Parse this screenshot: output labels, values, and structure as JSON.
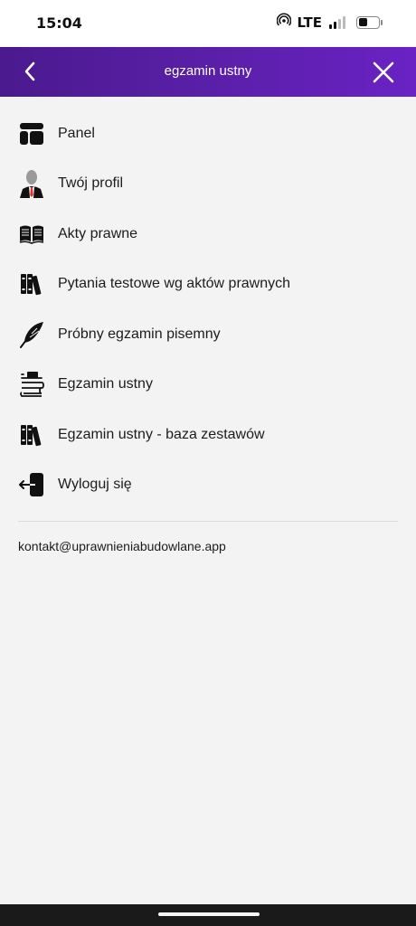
{
  "status_bar": {
    "time": "15:04",
    "network": "LTE"
  },
  "header": {
    "title": "egzamin ustny",
    "back_icon": "chevron-left-icon",
    "close_icon": "close-icon",
    "background_start": "#4a1a8e",
    "background_end": "#6a22c4"
  },
  "menu": {
    "items": [
      {
        "label": "Panel",
        "icon": "dashboard-icon"
      },
      {
        "label": "Twój profil",
        "icon": "user-profile-icon"
      },
      {
        "label": "Akty prawne",
        "icon": "open-book-icon"
      },
      {
        "label": "Pytania testowe wg aktów prawnych",
        "icon": "books-icon"
      },
      {
        "label": "Próbny egzamin pisemny",
        "icon": "feather-icon"
      },
      {
        "label": "Egzamin ustny",
        "icon": "scroll-icon"
      },
      {
        "label": "Egzamin ustny - baza zestawów",
        "icon": "books-icon"
      },
      {
        "label": "Wyloguj się",
        "icon": "logout-icon"
      }
    ]
  },
  "footer": {
    "contact_email": "kontakt@uprawnieniabudowlane.app"
  }
}
